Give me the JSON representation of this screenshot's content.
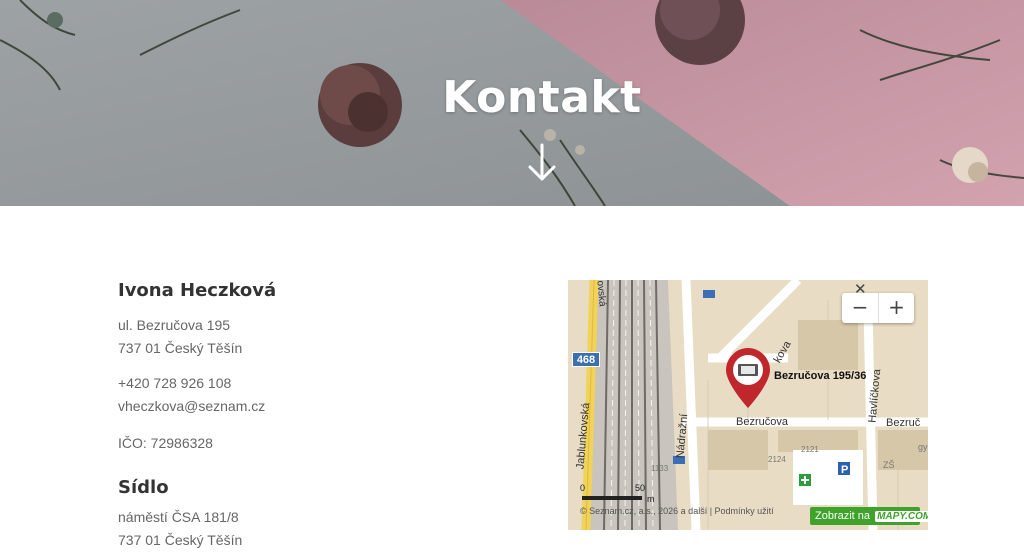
{
  "hero": {
    "title": "Kontakt",
    "arrow_icon": "arrow-down-icon",
    "colors": {
      "gray_bg": "#9a9fa1",
      "pink_bg": "#c89aa6",
      "text": "#ffffff"
    }
  },
  "contact": {
    "name": "Ivona Heczková",
    "address_line1": "ul. Bezručova 195",
    "address_line2": "737 01 Český Těšín",
    "phone": "+420 728 926 108",
    "email": "vheczkova@seznam.cz",
    "ico": "IČO: 72986328"
  },
  "sidlo": {
    "title": "Sídlo",
    "address_line1": "náměstí ČSA 181/8",
    "address_line2": "737 01 Český Těšín"
  },
  "map": {
    "zoom_out": "−",
    "zoom_in": "+",
    "close": "✕",
    "pin_label": "Bezručova 195/36",
    "road_number": "468",
    "streets": {
      "bezrucova_1": "Bezručova",
      "bezrucova_2": "Bezruč",
      "jablunkovska": "Jablunkovská",
      "nadrazni": "Nádražní",
      "havlickova": "Havlíčkova",
      "kova": "kova",
      "sko": "ovská"
    },
    "building_numbers": [
      "1133",
      "2124",
      "2121",
      "ZŠ",
      "gy"
    ],
    "scale": {
      "zero": "0",
      "fifty": "50",
      "unit": "m"
    },
    "copyright": "© Seznam.cz, a.s., 2026 a další",
    "terms": "Podmínky užití",
    "open_button": "Zobrazit na",
    "open_button_logo": "MAPY.COM",
    "accent": "#3fa32b"
  }
}
